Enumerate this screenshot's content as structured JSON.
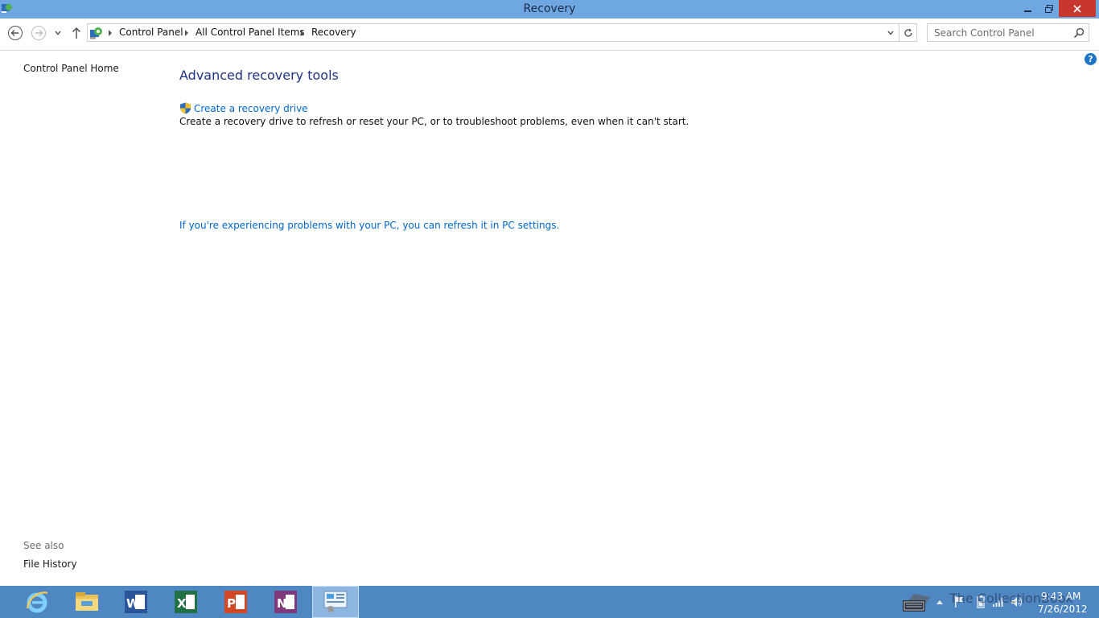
{
  "window": {
    "title": "Recovery"
  },
  "address_bar": {
    "breadcrumbs": [
      "Control Panel",
      "All Control Panel Items",
      "Recovery"
    ]
  },
  "search": {
    "placeholder": "Search Control Panel"
  },
  "left_pane": {
    "home_link": "Control Panel Home",
    "see_also_label": "See also",
    "see_also_items": [
      "File History"
    ]
  },
  "main": {
    "title": "Advanced recovery tools",
    "recovery_drive_link": "Create a recovery drive",
    "recovery_drive_description": "Create a recovery drive to refresh or reset your PC, or to troubleshoot problems, even when it can't start.",
    "refresh_link": "If you're experiencing problems with your PC, you can refresh it in PC settings."
  },
  "taskbar": {
    "watermark": "The CollectionBook",
    "clock_time": "9:43 AM",
    "clock_date": "7/26/2012"
  },
  "colors": {
    "titlebar": "#6fa7e3",
    "taskbar": "#4f87c3",
    "link": "#0066cc",
    "heading": "#1e3287",
    "close_button": "#c7372d"
  }
}
